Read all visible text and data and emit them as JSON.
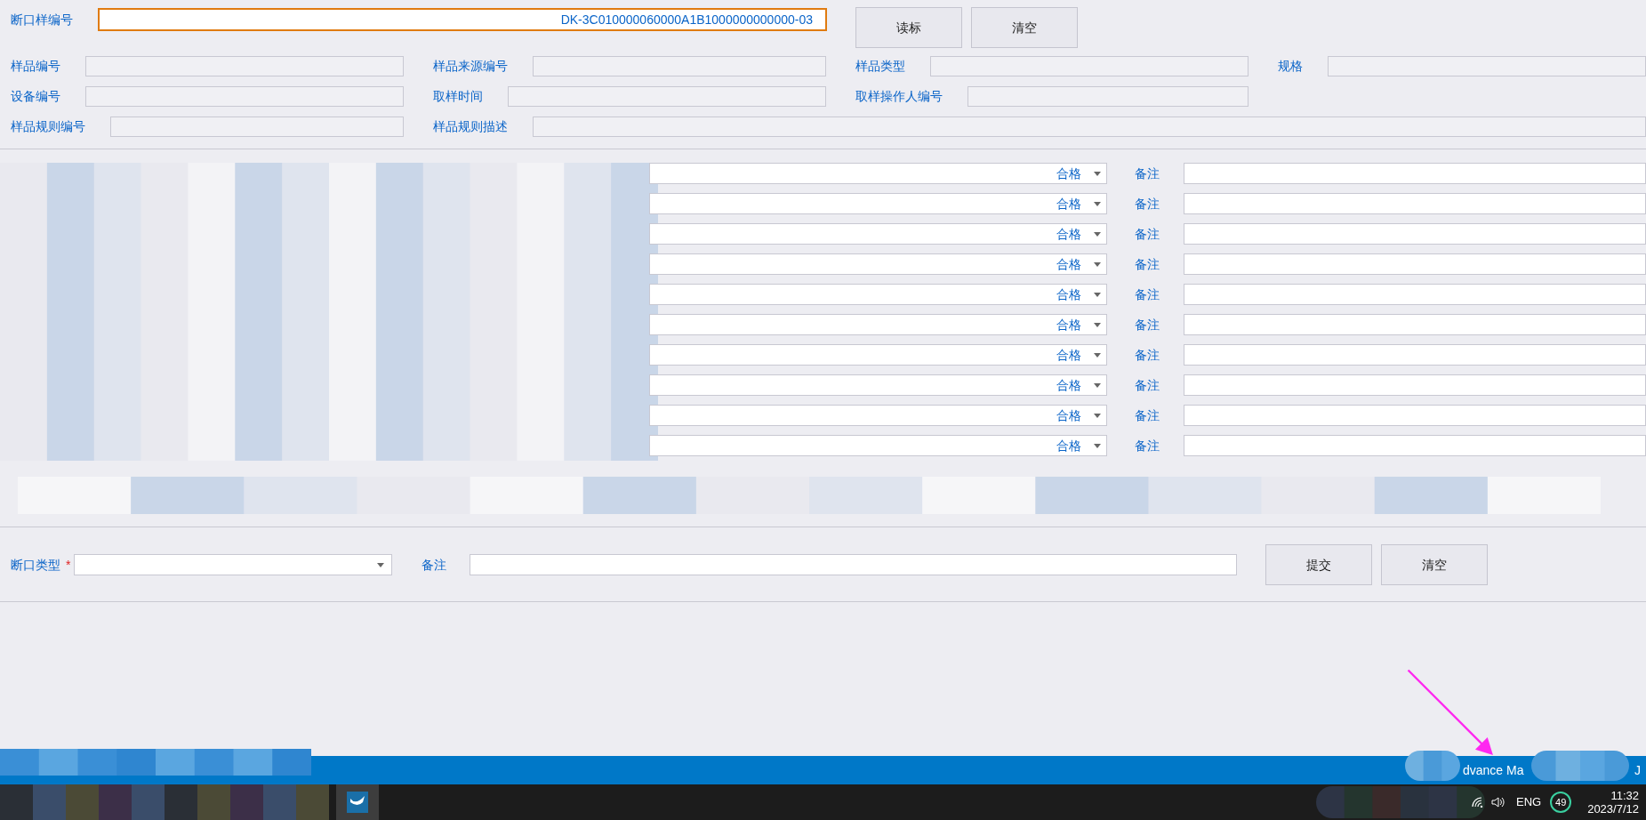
{
  "header": {
    "label": "断口样编号",
    "value": "DK-3C010000060000A1B1000000000000-03",
    "buttons": [
      "读标",
      "清空"
    ]
  },
  "info_rows": [
    [
      {
        "label": "样品编号"
      },
      {
        "label": "样品来源编号"
      },
      {
        "label": "样品类型"
      },
      {
        "label": "规格"
      }
    ],
    [
      {
        "label": "设备编号"
      },
      {
        "label": "取样时间"
      },
      {
        "label": "取样操作人编号"
      }
    ],
    [
      {
        "label": "样品规则编号"
      },
      {
        "label": "样品规则描述"
      }
    ]
  ],
  "result_rows": [
    {
      "status": "合格",
      "remark_label": "备注"
    },
    {
      "status": "合格",
      "remark_label": "备注"
    },
    {
      "status": "合格",
      "remark_label": "备注"
    },
    {
      "status": "合格",
      "remark_label": "备注"
    },
    {
      "status": "合格",
      "remark_label": "备注"
    },
    {
      "status": "合格",
      "remark_label": "备注"
    },
    {
      "status": "合格",
      "remark_label": "备注"
    },
    {
      "status": "合格",
      "remark_label": "备注"
    },
    {
      "status": "合格",
      "remark_label": "备注"
    },
    {
      "status": "合格",
      "remark_label": "备注"
    }
  ],
  "footer_form": {
    "type_label": "断口类型",
    "required_marker": "*",
    "remark_label": "备注",
    "buttons": [
      "提交",
      "清空"
    ]
  },
  "status_bar": {
    "texts": [
      "dvance Ma",
      "J"
    ]
  },
  "taskbar": {
    "language": "ENG",
    "badge": "49",
    "time": "11:32",
    "date": "2023/7/12"
  }
}
